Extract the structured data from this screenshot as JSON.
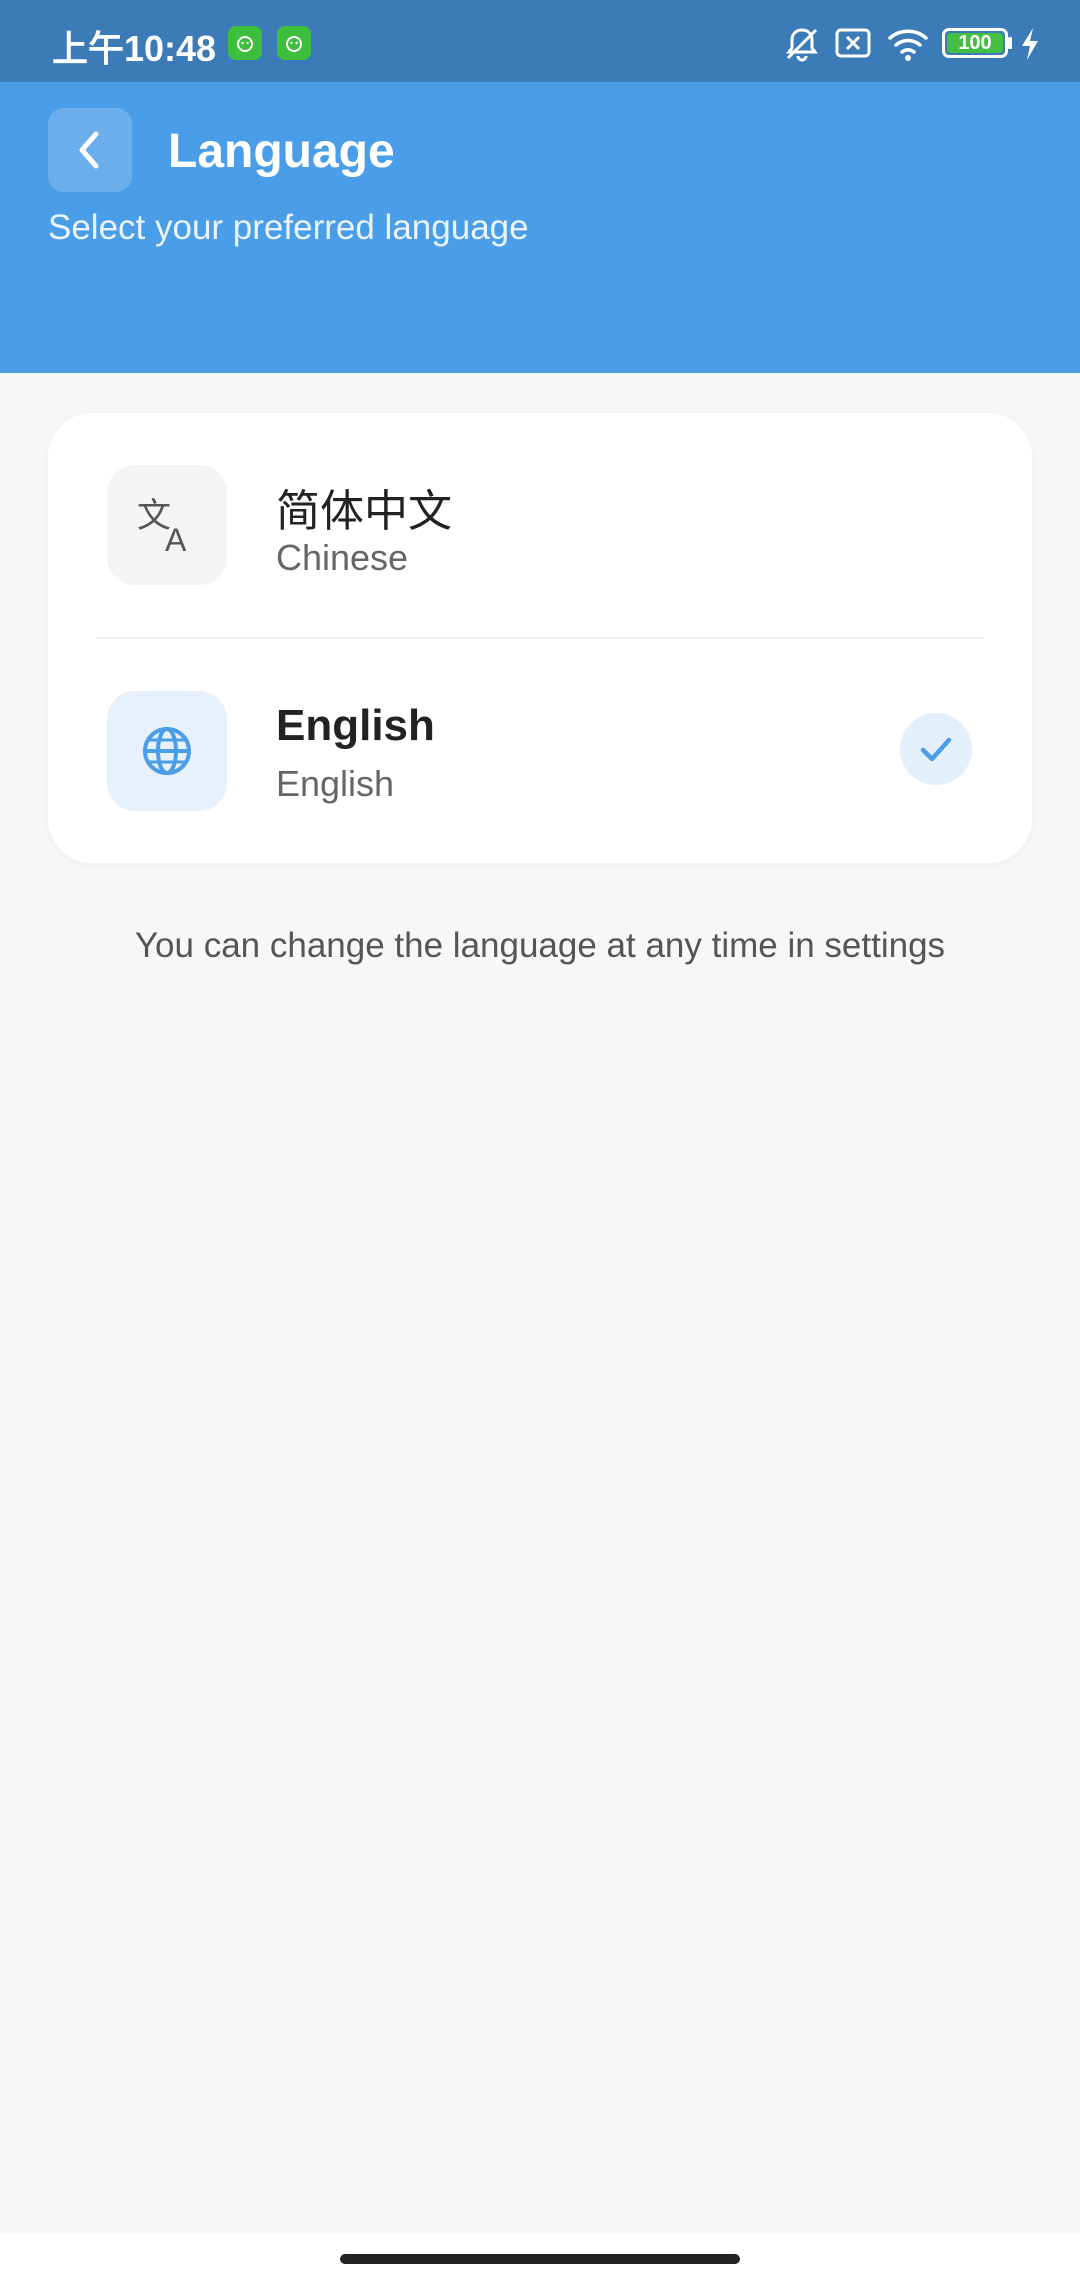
{
  "status_bar": {
    "time": "上午10:48",
    "battery": "100",
    "icons": [
      "app-notification-icon",
      "app-notification-icon",
      "silent-bell-icon",
      "sim-off-icon",
      "wifi-icon",
      "battery-icon",
      "charging-bolt-icon"
    ]
  },
  "header": {
    "title": "Language",
    "subtitle": "Select your preferred language",
    "back_icon": "chevron-left-icon"
  },
  "languages": [
    {
      "name": "简体中文",
      "sub": "Chinese",
      "icon": "translate-icon",
      "selected": false
    },
    {
      "name": "English",
      "sub": "English",
      "icon": "globe-icon",
      "selected": true
    }
  ],
  "footer_note": "You can change the language at any time in settings",
  "colors": {
    "status_bar": "#3B7BB8",
    "header": "#4A9EE8",
    "accent": "#4A9EE8",
    "background": "#F6F7F9"
  }
}
